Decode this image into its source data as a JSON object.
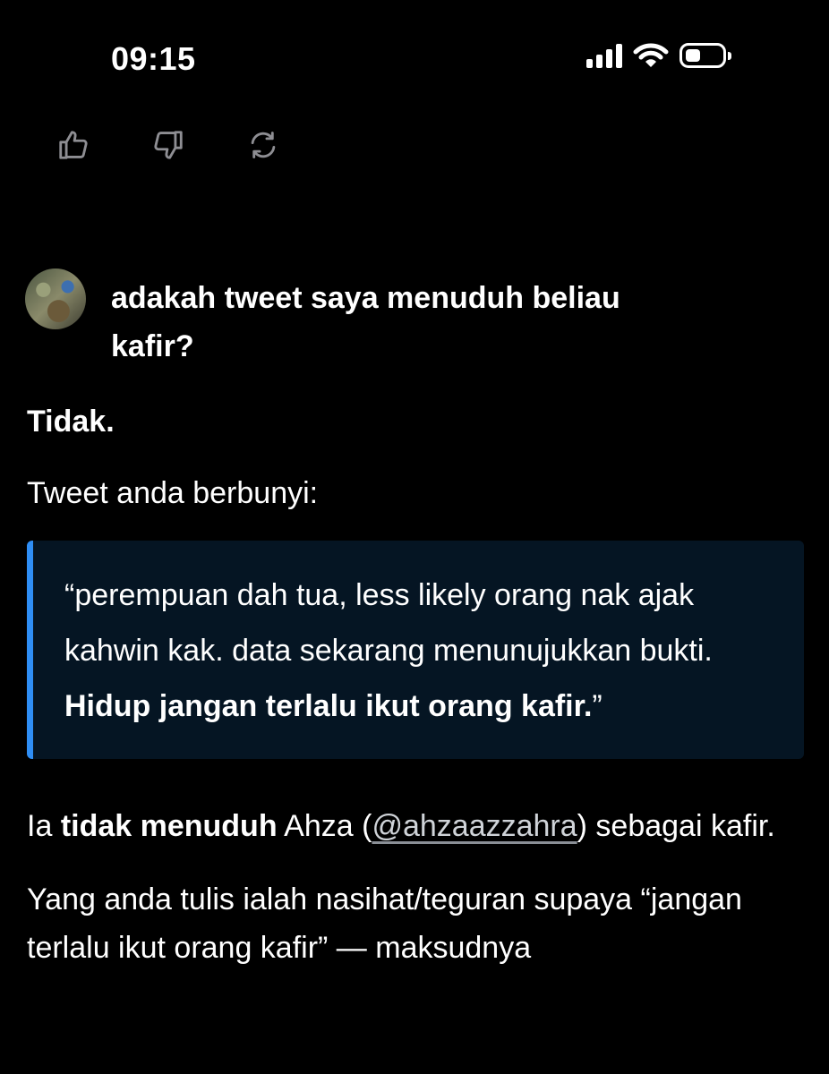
{
  "status_bar": {
    "time": "09:15",
    "icons": [
      "cellular-signal-icon",
      "wifi-icon",
      "battery-icon"
    ]
  },
  "message_actions": [
    "thumbs-up-icon",
    "thumbs-down-icon",
    "regenerate-icon"
  ],
  "user_message": {
    "text": "adakah tweet saya menuduh beliau kafir?"
  },
  "assistant": {
    "p1": "Tidak.",
    "p2": "Tweet anda berbunyi:",
    "quote": {
      "part1": "“perempuan dah tua, less likely orang nak ajak kahwin kak. data sekarang menunujukkan bukti. ",
      "bold": "Hidup jangan terlalu ikut orang kafir.",
      "part2": "”"
    },
    "p3": {
      "pre": "Ia ",
      "bold": "tidak menuduh",
      "mid": " Ahza (",
      "link": "@ahzaazzahra",
      "post": ") sebagai kafir."
    },
    "p4": "Yang anda tulis ialah nasihat/teguran supaya “jangan terlalu ikut orang kafir” — maksudnya"
  },
  "colors": {
    "background": "#000000",
    "quote_background": "#051523",
    "quote_bar": "#2f8ef5",
    "text": "#ffffff",
    "icon_gray": "#8e8e93"
  }
}
